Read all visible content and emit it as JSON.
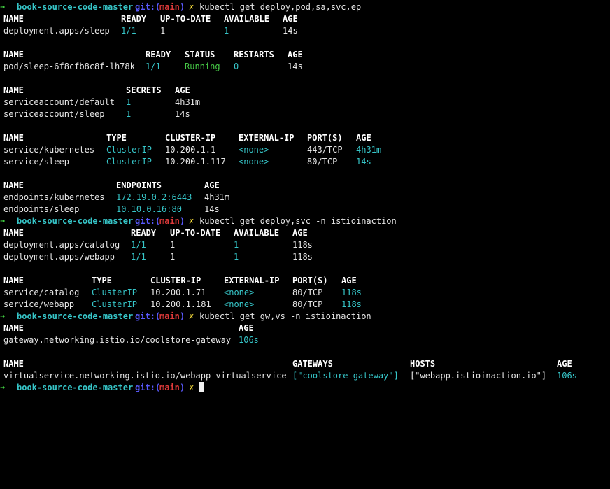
{
  "prompt": {
    "arrow": "➜",
    "dir": "book-source-code-master",
    "git_label": "git:(",
    "branch": "main",
    "git_close": ")",
    "dirty": "✗"
  },
  "commands": {
    "c1": "kubectl get deploy,pod,sa,svc,ep",
    "c2": "kubectl get deploy,svc -n istioinaction",
    "c3": "kubectl get gw,vs -n istioinaction"
  },
  "deploy1": {
    "headers": [
      "NAME",
      "READY",
      "UP-TO-DATE",
      "AVAILABLE",
      "AGE"
    ],
    "rows": [
      [
        "deployment.apps/sleep",
        "1/1",
        "1",
        "1",
        "14s"
      ]
    ]
  },
  "pods": {
    "headers": [
      "NAME",
      "READY",
      "STATUS",
      "RESTARTS",
      "AGE"
    ],
    "rows": [
      [
        "pod/sleep-6f8cfb8c8f-lh78k",
        "1/1",
        "Running",
        "0",
        "14s"
      ]
    ]
  },
  "sa": {
    "headers": [
      "NAME",
      "SECRETS",
      "AGE"
    ],
    "rows": [
      [
        "serviceaccount/default",
        "1",
        "4h31m"
      ],
      [
        "serviceaccount/sleep",
        "1",
        "14s"
      ]
    ]
  },
  "svc1": {
    "headers": [
      "NAME",
      "TYPE",
      "CLUSTER-IP",
      "EXTERNAL-IP",
      "PORT(S)",
      "AGE"
    ],
    "rows": [
      [
        "service/kubernetes",
        "ClusterIP",
        "10.200.1.1",
        "<none>",
        "443/TCP",
        "4h31m"
      ],
      [
        "service/sleep",
        "ClusterIP",
        "10.200.1.117",
        "<none>",
        "80/TCP",
        "14s"
      ]
    ]
  },
  "ep": {
    "headers": [
      "NAME",
      "ENDPOINTS",
      "AGE"
    ],
    "rows": [
      [
        "endpoints/kubernetes",
        "172.19.0.2:6443",
        "4h31m"
      ],
      [
        "endpoints/sleep",
        "10.10.0.16:80",
        "14s"
      ]
    ]
  },
  "deploy2": {
    "headers": [
      "NAME",
      "READY",
      "UP-TO-DATE",
      "AVAILABLE",
      "AGE"
    ],
    "rows": [
      [
        "deployment.apps/catalog",
        "1/1",
        "1",
        "1",
        "118s"
      ],
      [
        "deployment.apps/webapp",
        "1/1",
        "1",
        "1",
        "118s"
      ]
    ]
  },
  "svc2": {
    "headers": [
      "NAME",
      "TYPE",
      "CLUSTER-IP",
      "EXTERNAL-IP",
      "PORT(S)",
      "AGE"
    ],
    "rows": [
      [
        "service/catalog",
        "ClusterIP",
        "10.200.1.71",
        "<none>",
        "80/TCP",
        "118s"
      ],
      [
        "service/webapp",
        "ClusterIP",
        "10.200.1.181",
        "<none>",
        "80/TCP",
        "118s"
      ]
    ]
  },
  "gw": {
    "headers": [
      "NAME",
      "AGE"
    ],
    "rows": [
      [
        "gateway.networking.istio.io/coolstore-gateway",
        "106s"
      ]
    ]
  },
  "vs": {
    "headers": [
      "NAME",
      "GATEWAYS",
      "HOSTS",
      "AGE"
    ],
    "rows": [
      [
        "virtualservice.networking.istio.io/webapp-virtualservice",
        "[\"coolstore-gateway\"]",
        "[\"webapp.istioinaction.io\"]",
        "106s"
      ]
    ]
  }
}
